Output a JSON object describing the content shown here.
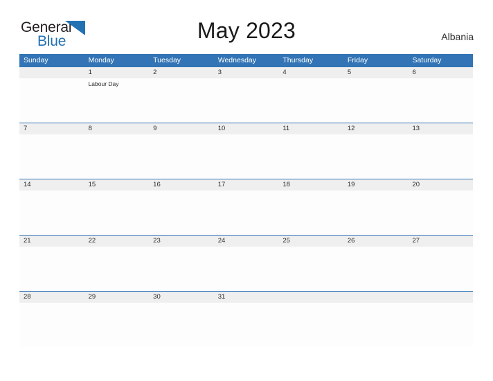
{
  "brand": {
    "name_part1": "General",
    "name_part2": "Blue",
    "flag_icon": "blue-triangle-flag-icon",
    "accent_color": "#2271b3"
  },
  "header": {
    "title": "May 2023",
    "country": "Albania"
  },
  "calendar": {
    "header_bg": "#3274b5",
    "date_band_bg": "#efefef",
    "weekdays": [
      "Sunday",
      "Monday",
      "Tuesday",
      "Wednesday",
      "Thursday",
      "Friday",
      "Saturday"
    ],
    "weeks": [
      {
        "dates": [
          "",
          "1",
          "2",
          "3",
          "4",
          "5",
          "6"
        ],
        "events": [
          [],
          [
            "Labour Day"
          ],
          [],
          [],
          [],
          [],
          []
        ]
      },
      {
        "dates": [
          "7",
          "8",
          "9",
          "10",
          "11",
          "12",
          "13"
        ],
        "events": [
          [],
          [],
          [],
          [],
          [],
          [],
          []
        ]
      },
      {
        "dates": [
          "14",
          "15",
          "16",
          "17",
          "18",
          "19",
          "20"
        ],
        "events": [
          [],
          [],
          [],
          [],
          [],
          [],
          []
        ]
      },
      {
        "dates": [
          "21",
          "22",
          "23",
          "24",
          "25",
          "26",
          "27"
        ],
        "events": [
          [],
          [],
          [],
          [],
          [],
          [],
          []
        ]
      },
      {
        "dates": [
          "28",
          "29",
          "30",
          "31",
          "",
          "",
          ""
        ],
        "events": [
          [],
          [],
          [],
          [],
          [],
          [],
          []
        ]
      }
    ]
  }
}
